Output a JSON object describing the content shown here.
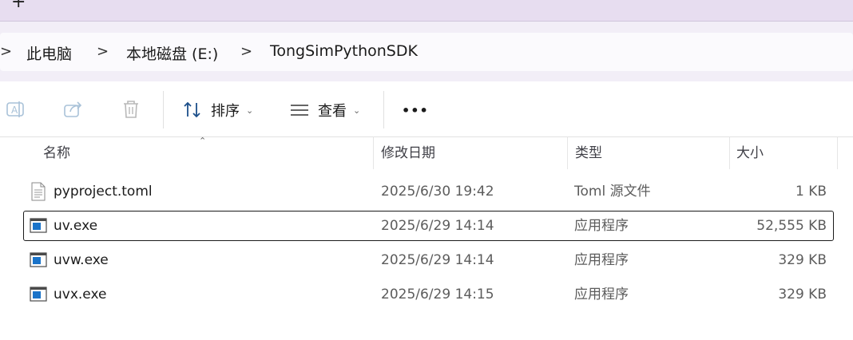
{
  "tabstrip": {
    "new_tab_glyph": "+"
  },
  "breadcrumb": {
    "items": [
      "此电脑",
      "本地磁盘 (E:)",
      "TongSimPythonSDK"
    ],
    "separator": ">"
  },
  "toolbar": {
    "rename_icon": "rename-icon",
    "share_icon": "share-icon",
    "delete_icon": "delete-icon",
    "sort_label": "排序",
    "view_label": "查看",
    "more_label": "•••"
  },
  "columns": {
    "name": "名称",
    "date": "修改日期",
    "type": "类型",
    "size": "大小"
  },
  "files": [
    {
      "name": "pyproject.toml",
      "date": "2025/6/30 19:42",
      "type": "Toml 源文件",
      "size": "1 KB",
      "icon": "text-file-icon",
      "selected": false
    },
    {
      "name": "uv.exe",
      "date": "2025/6/29 14:14",
      "type": "应用程序",
      "size": "52,555 KB",
      "icon": "app-icon",
      "selected": true
    },
    {
      "name": "uvw.exe",
      "date": "2025/6/29 14:14",
      "type": "应用程序",
      "size": "329 KB",
      "icon": "app-icon",
      "selected": false
    },
    {
      "name": "uvx.exe",
      "date": "2025/6/29 14:15",
      "type": "应用程序",
      "size": "329 KB",
      "icon": "app-icon",
      "selected": false
    }
  ],
  "colors": {
    "tabstrip_bg": "#e7ddf0",
    "address_bg": "#f2eef7",
    "app_icon_blue": "#1a73c9"
  }
}
